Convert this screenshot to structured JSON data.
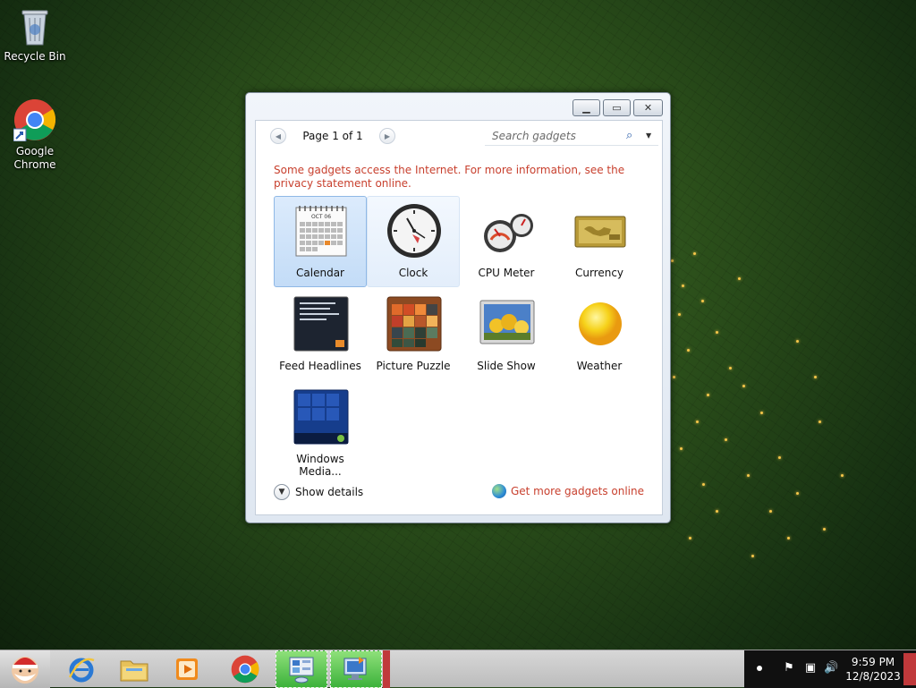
{
  "desktop": {
    "icons": [
      {
        "label": "Recycle Bin",
        "icon": "recycle-bin-icon"
      },
      {
        "label": "Google\nChrome",
        "icon": "chrome-icon"
      }
    ]
  },
  "gadget_window": {
    "controls": {
      "minimize": "minimize",
      "restore": "restore",
      "close": "close"
    },
    "pager": {
      "text": "Page 1 of 1"
    },
    "search": {
      "placeholder": "Search gadgets"
    },
    "notice": "Some gadgets access the Internet.  For more information, see the privacy statement online.",
    "gadgets": [
      {
        "label": "Calendar",
        "icon": "calendar-icon",
        "selected": true
      },
      {
        "label": "Clock",
        "icon": "clock-icon",
        "hover": true
      },
      {
        "label": "CPU Meter",
        "icon": "cpu-meter-icon"
      },
      {
        "label": "Currency",
        "icon": "currency-icon"
      },
      {
        "label": "Feed Headlines",
        "icon": "feed-headlines-icon"
      },
      {
        "label": "Picture Puzzle",
        "icon": "picture-puzzle-icon"
      },
      {
        "label": "Slide Show",
        "icon": "slide-show-icon"
      },
      {
        "label": "Weather",
        "icon": "weather-icon"
      },
      {
        "label": "Windows Media...",
        "icon": "windows-media-center-icon"
      }
    ],
    "calendar_thumb": {
      "month": "OCT 06"
    },
    "show_details": "Show details",
    "get_more": "Get more gadgets online"
  },
  "taskbar": {
    "start_icon": "santa-start-icon",
    "pinned": [
      "internet-explorer-icon",
      "file-explorer-icon",
      "media-player-icon",
      "chrome-icon",
      "control-panel-icon",
      "remote-desktop-icon"
    ],
    "clock": {
      "time": "9:59 PM",
      "date": "12/8/2023"
    }
  },
  "colors": {
    "notice_red": "#c8402e",
    "taskbar_active": "#4fc14a"
  }
}
